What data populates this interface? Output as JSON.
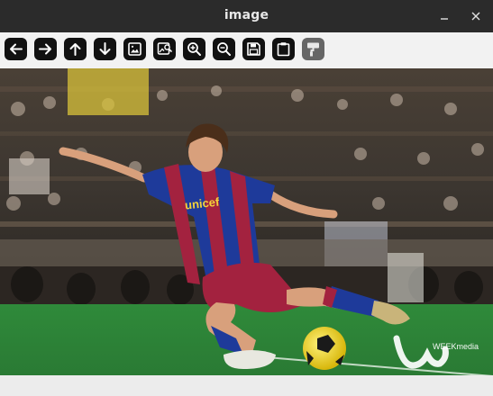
{
  "window": {
    "title": "image"
  },
  "window_controls": {
    "minimize": "minimize-icon",
    "close": "close-icon"
  },
  "toolbar": {
    "buttons": [
      {
        "icon": "arrow-left-icon"
      },
      {
        "icon": "arrow-right-icon"
      },
      {
        "icon": "arrow-up-icon"
      },
      {
        "icon": "arrow-down-icon"
      },
      {
        "icon": "image-icon"
      },
      {
        "icon": "image-search-icon"
      },
      {
        "icon": "zoom-in-icon"
      },
      {
        "icon": "zoom-out-icon"
      },
      {
        "icon": "save-icon"
      },
      {
        "icon": "clipboard-icon"
      },
      {
        "icon": "paint-roller-icon"
      }
    ]
  },
  "image": {
    "jersey_text": "unicef",
    "watermark_text": "WEEKmedia"
  }
}
